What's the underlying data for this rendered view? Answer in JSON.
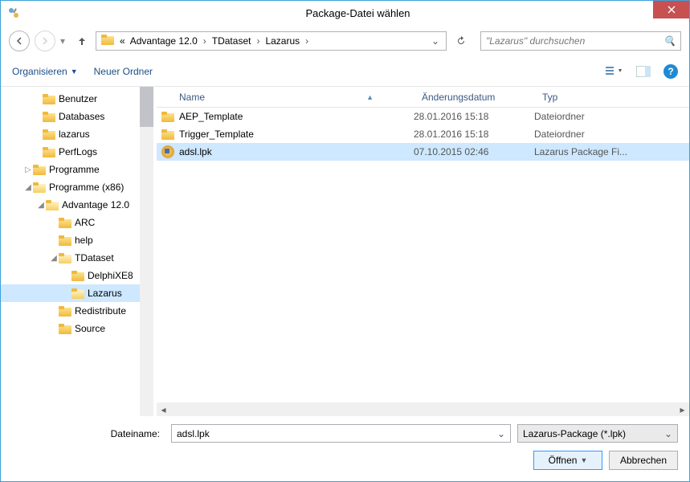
{
  "title": "Package-Datei wählen",
  "breadcrumbs": {
    "b0": "«",
    "b1": "Advantage 12.0",
    "b2": "TDataset",
    "b3": "Lazarus"
  },
  "search_placeholder": "\"Lazarus\" durchsuchen",
  "toolbar": {
    "organize": "Organisieren",
    "newfolder": "Neuer Ordner"
  },
  "columns": {
    "name": "Name",
    "date": "Änderungsdatum",
    "type": "Typ"
  },
  "tree": {
    "t0": "Benutzer",
    "t1": "Databases",
    "t2": "lazarus",
    "t3": "PerfLogs",
    "t4": "Programme",
    "t5": "Programme (x86)",
    "t6": "Advantage 12.0",
    "t7": "ARC",
    "t8": "help",
    "t9": "TDataset",
    "t10": "DelphiXE8",
    "t11": "Lazarus",
    "t12": "Redistribute",
    "t13": "Source"
  },
  "rows": {
    "r0": {
      "name": "AEP_Template",
      "date": "28.01.2016 15:18",
      "type": "Dateiordner"
    },
    "r1": {
      "name": "Trigger_Template",
      "date": "28.01.2016 15:18",
      "type": "Dateiordner"
    },
    "r2": {
      "name": "adsl.lpk",
      "date": "07.10.2015 02:46",
      "type": "Lazarus Package Fi..."
    }
  },
  "filename_label": "Dateiname:",
  "filename_value": "adsl.lpk",
  "filter": "Lazarus-Package (*.lpk)",
  "buttons": {
    "open": "Öffnen",
    "cancel": "Abbrechen"
  }
}
